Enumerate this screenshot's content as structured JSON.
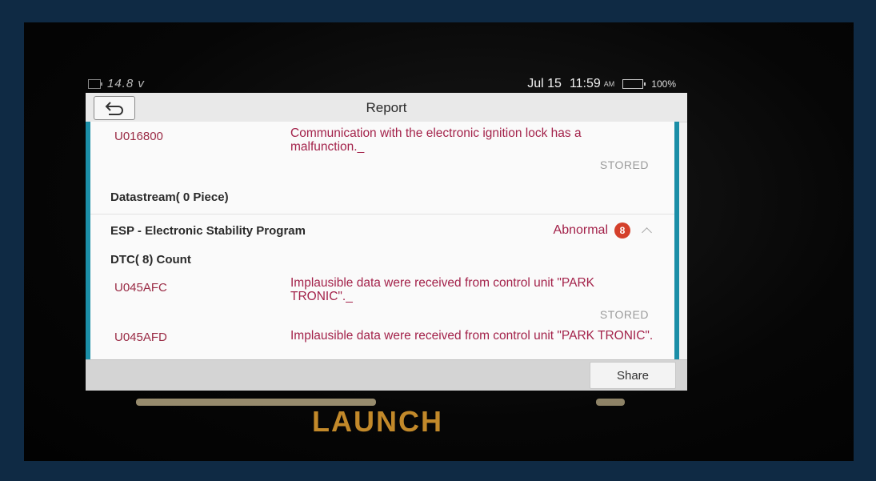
{
  "status_bar": {
    "voltage": "14.8 v",
    "date": "Jul 15",
    "time": "11:59",
    "ampm": "AM",
    "battery_pct": "100%",
    "battery_level": 1.0
  },
  "header": {
    "title": "Report",
    "back_icon": "back-arrow-icon"
  },
  "report": {
    "dtc_1": {
      "code": "U016800",
      "description": "Communication with the electronic ignition lock has a malfunction._",
      "status": "STORED"
    },
    "datastream_heading": "Datastream( 0 Piece)",
    "module": {
      "name": "ESP - Electronic Stability Program",
      "status": "Abnormal",
      "count": "8"
    },
    "dtc_count_heading": "DTC( 8) Count",
    "dtc_2": {
      "code": "U045AFC",
      "description": "Implausible data were received from control unit \"PARK TRONIC\"._",
      "status": "STORED"
    },
    "dtc_3": {
      "code": "U045AFD",
      "description": "Implausible data were received from control unit \"PARK TRONIC\"."
    }
  },
  "footer": {
    "share_label": "Share"
  },
  "device": {
    "brand": "LAUNCH"
  },
  "colors": {
    "accent": "#1b8ea7",
    "dtc_text": "#a3224a",
    "badge": "#d4402b",
    "battery": "#27c227"
  }
}
